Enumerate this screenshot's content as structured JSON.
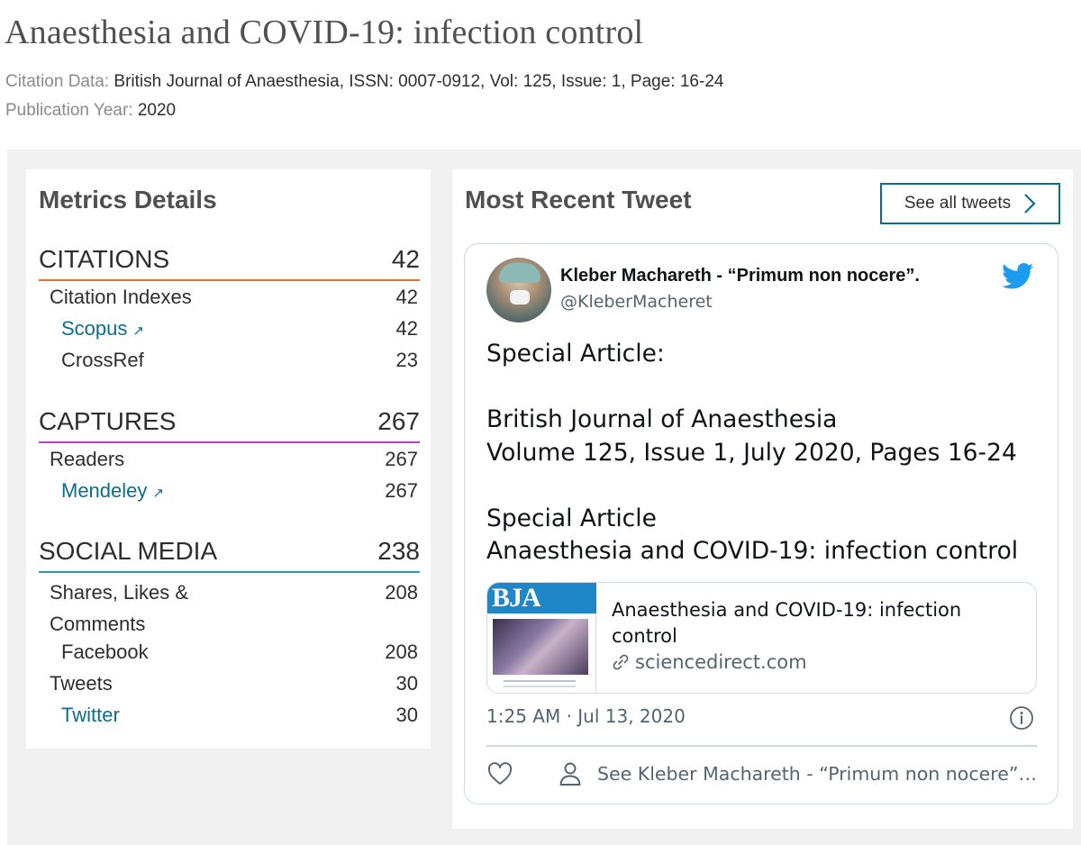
{
  "page": {
    "title": "Anaesthesia and COVID-19: infection control",
    "citation_label": "Citation Data:",
    "citation_value": "British Journal of Anaesthesia, ISSN: 0007-0912, Vol: 125, Issue: 1, Page: 16-24",
    "year_label": "Publication Year:",
    "year_value": "2020"
  },
  "metrics": {
    "heading": "Metrics Details",
    "citations": {
      "label": "CITATIONS",
      "value": "42",
      "rows": [
        {
          "label": "Citation Indexes",
          "value": "42"
        },
        {
          "label": "Scopus",
          "value": "42"
        },
        {
          "label": "CrossRef",
          "value": "23"
        }
      ]
    },
    "captures": {
      "label": "CAPTURES",
      "value": "267",
      "rows": [
        {
          "label": "Readers",
          "value": "267"
        },
        {
          "label": "Mendeley",
          "value": "267"
        }
      ]
    },
    "social": {
      "label": "SOCIAL MEDIA",
      "value": "238",
      "rows": [
        {
          "label": "Shares, Likes & Comments",
          "value": "208"
        },
        {
          "label": "Facebook",
          "value": "208"
        },
        {
          "label": "Tweets",
          "value": "30"
        },
        {
          "label": "Twitter",
          "value": "30"
        }
      ]
    },
    "external_icon": "external-link-icon",
    "colors": {
      "citations": "#e8702a",
      "captures": "#b83fc6",
      "social": "#2a98b8",
      "link": "#0a6e8c"
    }
  },
  "tweet_panel": {
    "heading": "Most Recent Tweet",
    "see_all_label": "See all tweets",
    "tweet": {
      "name": "Kleber Machareth - “Primum non nocere”.",
      "handle": "@KleberMacheret",
      "body": "Special Article:\n\nBritish Journal of Anaesthesia\nVolume 125, Issue 1, July 2020, Pages 16-24\n\nSpecial Article\nAnaesthesia and COVID-19: infection control",
      "card": {
        "thumb_text": "BJA",
        "title": "Anaesthesia and COVID-19: infection control",
        "domain": "sciencedirect.com"
      },
      "timestamp": "1:25 AM · Jul 13, 2020",
      "see_profile": "See Kleber Machareth - “Primum non nocere”.’s other Tweets",
      "icons": [
        "twitter-bird-icon",
        "link-icon",
        "info-icon",
        "heart-icon",
        "user-icon"
      ],
      "brand_color": "#1d9bf0"
    }
  }
}
